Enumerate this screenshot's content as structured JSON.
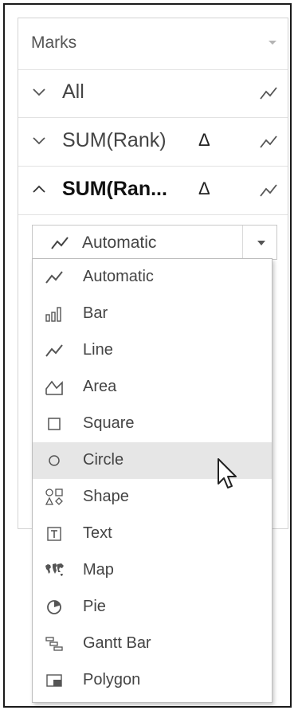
{
  "marks": {
    "title": "Marks",
    "rows": [
      {
        "label": "All",
        "delta": "",
        "expanded": false,
        "selected": false
      },
      {
        "label": "SUM(Rank)",
        "delta": "Δ",
        "expanded": false,
        "selected": false
      },
      {
        "label": "SUM(Ran...",
        "delta": "Δ",
        "expanded": true,
        "selected": true
      }
    ]
  },
  "mark_type_select": {
    "value": "Automatic",
    "icon": "line-icon"
  },
  "menu": {
    "items": [
      {
        "label": "Automatic",
        "icon": "line-icon"
      },
      {
        "label": "Bar",
        "icon": "bar-chart-icon"
      },
      {
        "label": "Line",
        "icon": "line-icon"
      },
      {
        "label": "Area",
        "icon": "area-icon"
      },
      {
        "label": "Square",
        "icon": "square-icon"
      },
      {
        "label": "Circle",
        "icon": "circle-icon",
        "hovered": true
      },
      {
        "label": "Shape",
        "icon": "shape-icon"
      },
      {
        "label": "Text",
        "icon": "text-icon"
      },
      {
        "label": "Map",
        "icon": "map-icon"
      },
      {
        "label": "Pie",
        "icon": "pie-icon"
      },
      {
        "label": "Gantt Bar",
        "icon": "gantt-bar-icon"
      },
      {
        "label": "Polygon",
        "icon": "polygon-icon"
      }
    ]
  },
  "colors": {
    "border": "#d4d4d4",
    "text": "#444444",
    "hover": "#e6e6e6",
    "icon": "#555555"
  }
}
